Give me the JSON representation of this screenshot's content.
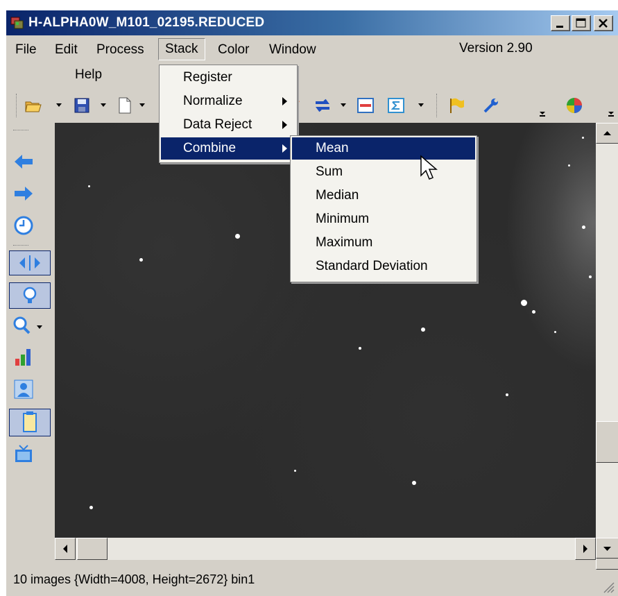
{
  "window": {
    "title": "H-ALPHA0W_M101_02195.REDUCED",
    "controls": [
      "minimize-icon",
      "maximize-icon",
      "close-icon"
    ]
  },
  "menubar": {
    "items": [
      "File",
      "Edit",
      "Process",
      "Stack",
      "Color",
      "Window",
      "Help"
    ],
    "version": "Version 2.90"
  },
  "stack_menu": {
    "items": [
      {
        "label": "Register",
        "submenu": false
      },
      {
        "label": "Normalize",
        "submenu": true
      },
      {
        "label": "Data Reject",
        "submenu": true
      },
      {
        "label": "Combine",
        "submenu": true,
        "highlighted": true
      }
    ]
  },
  "combine_menu": {
    "items": [
      {
        "label": "Mean",
        "highlighted": true
      },
      {
        "label": "Sum"
      },
      {
        "label": "Median"
      },
      {
        "label": "Minimum"
      },
      {
        "label": "Maximum"
      },
      {
        "label": "Standard Deviation"
      }
    ]
  },
  "toolbar": {
    "icons": [
      "open-folder-icon",
      "save-icon",
      "new-document-icon",
      "fits-icon",
      "swap-icon",
      "minus-icon",
      "sigma-icon",
      "flag-icon",
      "wrench-icon",
      "color-wheel-icon"
    ]
  },
  "left_toolbar": {
    "icons": [
      "back-arrow-icon",
      "forward-arrow-icon",
      "clock-icon",
      "split-view-icon",
      "lightbulb-icon",
      "zoom-icon",
      "histogram-icon",
      "user-icon",
      "clipboard-icon",
      "monitor-icon"
    ]
  },
  "statusbar": {
    "text": "10 images  {Width=4008, Height=2672} bin1"
  },
  "colors": {
    "title_start": "#0a246a",
    "title_end": "#a6caf0",
    "highlight": "#0a246a",
    "window_bg": "#d4d0c8",
    "canvas_bg": "#2c2c2c"
  }
}
